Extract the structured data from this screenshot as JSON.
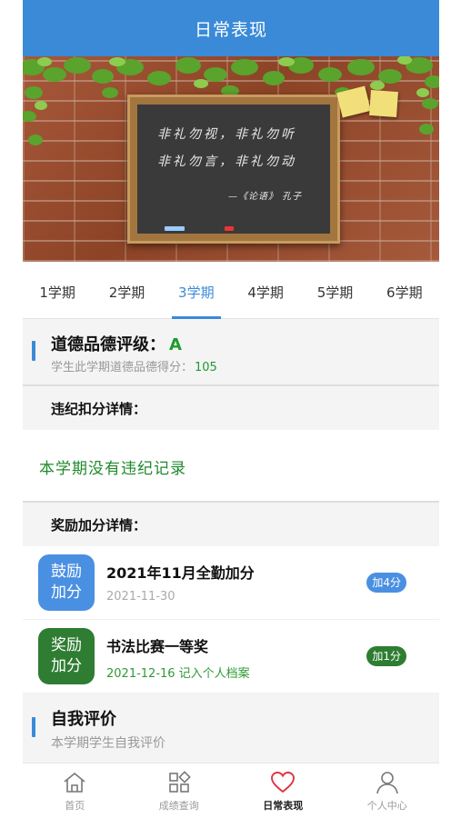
{
  "header": {
    "title": "日常表现"
  },
  "banner": {
    "line1": "非礼勿视，非礼勿听",
    "line2": "非礼勿言，非礼勿动",
    "signature": "—《论语》 孔子"
  },
  "tabs": [
    {
      "label": "1学期"
    },
    {
      "label": "2学期"
    },
    {
      "label": "3学期",
      "active": true
    },
    {
      "label": "4学期"
    },
    {
      "label": "5学期"
    },
    {
      "label": "6学期"
    }
  ],
  "moral": {
    "title": "道德品德评级：",
    "grade": "A",
    "subtitle": "学生此学期道德品德得分：",
    "score": "105"
  },
  "violations": {
    "heading": "违纪扣分详情：",
    "empty_text": "本学期没有违纪记录"
  },
  "rewards": {
    "heading": "奖励加分详情：",
    "items": [
      {
        "badge_line1": "鼓励",
        "badge_line2": "加分",
        "badge_color": "#4a90e2",
        "title": "2021年11月全勤加分",
        "date": "2021-11-30",
        "points": "加4分",
        "points_color": "#4a90e2"
      },
      {
        "badge_line1": "奖励",
        "badge_line2": "加分",
        "badge_color": "#2e7d32",
        "title": "书法比赛一等奖",
        "date": "2021-12-16 记入个人档案",
        "points": "加1分",
        "points_color": "#2e7d32"
      }
    ]
  },
  "self_eval": {
    "title": "自我评价",
    "subtitle": "本学期学生自我评价"
  },
  "nav": [
    {
      "label": "首页",
      "icon": "home-icon"
    },
    {
      "label": "成绩查询",
      "icon": "grid-icon"
    },
    {
      "label": "日常表现",
      "icon": "heart-icon",
      "active": true
    },
    {
      "label": "个人中心",
      "icon": "person-icon"
    }
  ],
  "colors": {
    "primary": "#3a8ad8",
    "green": "#1f9a2b"
  }
}
